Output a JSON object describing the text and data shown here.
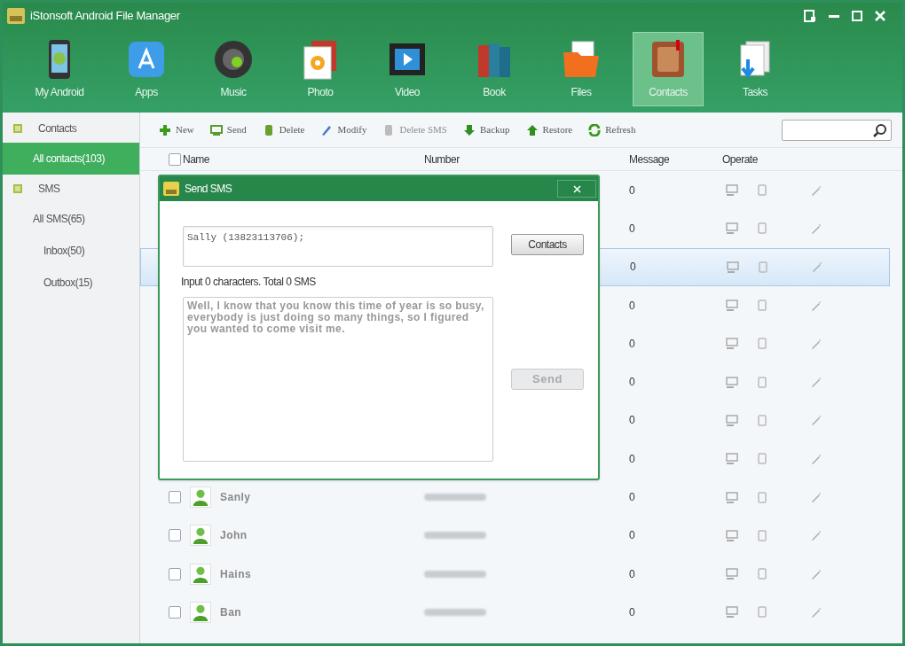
{
  "window": {
    "title": "iStonsoft Android File Manager"
  },
  "nav": [
    {
      "label": "My Android",
      "selected": false
    },
    {
      "label": "Apps",
      "selected": false
    },
    {
      "label": "Music",
      "selected": false
    },
    {
      "label": "Photo",
      "selected": false
    },
    {
      "label": "Video",
      "selected": false
    },
    {
      "label": "Book",
      "selected": false
    },
    {
      "label": "Files",
      "selected": false
    },
    {
      "label": "Contacts",
      "selected": true
    },
    {
      "label": "Tasks",
      "selected": false
    }
  ],
  "sidebar": {
    "sections": [
      {
        "label": "Contacts",
        "children": [
          {
            "label": "All contacts(103)",
            "selected": true
          }
        ]
      },
      {
        "label": "SMS",
        "children": [
          {
            "label": "All SMS(65)",
            "selected": false,
            "children": [
              {
                "label": "Inbox(50)",
                "selected": false
              },
              {
                "label": "Outbox(15)",
                "selected": false
              }
            ]
          }
        ]
      }
    ]
  },
  "toolbar": [
    {
      "label": "New",
      "disabled": false
    },
    {
      "label": "Send",
      "disabled": false
    },
    {
      "label": "Delete",
      "disabled": false
    },
    {
      "label": "Modify",
      "disabled": false
    },
    {
      "label": "Delete SMS",
      "disabled": true
    },
    {
      "label": "Backup",
      "disabled": false
    },
    {
      "label": "Restore",
      "disabled": false
    },
    {
      "label": "Refresh",
      "disabled": false
    }
  ],
  "table": {
    "columns": [
      "Name",
      "Number",
      "Message",
      "Operate"
    ],
    "select_all_checked": false,
    "rows": [
      {
        "selected": false,
        "message": "0"
      },
      {
        "selected": false,
        "message": "0"
      },
      {
        "selected": true,
        "message": "0"
      },
      {
        "selected": false,
        "message": "0"
      },
      {
        "selected": false,
        "message": "0"
      },
      {
        "selected": false,
        "message": "0"
      },
      {
        "selected": false,
        "message": "0"
      },
      {
        "selected": false,
        "message": "0"
      },
      {
        "checked": false,
        "selected": false,
        "name": "Sanly",
        "message": "0"
      },
      {
        "checked": false,
        "selected": false,
        "name": "John",
        "message": "0"
      },
      {
        "checked": false,
        "selected": false,
        "name": "Hains",
        "message": "0"
      },
      {
        "checked": false,
        "selected": false,
        "name": "Ban",
        "message": "0"
      }
    ]
  },
  "dialog": {
    "title": "Send SMS",
    "recipients": "Sally (13823113706);",
    "contacts_button": "Contacts",
    "counter": "Input 0 characters. Total 0 SMS",
    "message": "Well, I know that you know this time of year is so busy, everybody is just doing so many things, so I figured you wanted to come visit me.",
    "send_button": "Send",
    "send_disabled": true
  }
}
